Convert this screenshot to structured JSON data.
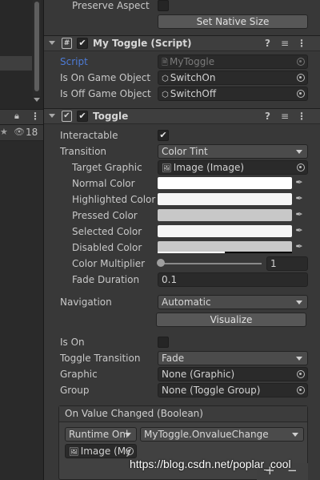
{
  "hierarchy": {
    "layer_count": "18",
    "lock_icon": "lock-icon",
    "menu_icon": "kebab-menu-icon",
    "star_icon": "star-icon",
    "eye_icon": "eye-slash-icon"
  },
  "top_partial": {
    "preserve_aspect_label": "Preserve Aspect",
    "preserve_aspect_checked": false,
    "set_native_size_label": "Set Native Size"
  },
  "my_toggle": {
    "title": "My Toggle (Script)",
    "enabled": true,
    "script_label": "Script",
    "script_value": "MyToggle",
    "is_on_label": "Is On Game Object",
    "is_on_value": "SwitchOn",
    "is_off_label": "Is Off Game Object",
    "is_off_value": "SwitchOff"
  },
  "toggle": {
    "title": "Toggle",
    "enabled": true,
    "interactable_label": "Interactable",
    "interactable_checked": true,
    "transition_label": "Transition",
    "transition_value": "Color Tint",
    "target_graphic_label": "Target Graphic",
    "target_graphic_value": "Image (Image)",
    "normal_color_label": "Normal Color",
    "normal_color": "#ffffff",
    "highlighted_color_label": "Highlighted Color",
    "highlighted_color": "#f5f5f5",
    "pressed_color_label": "Pressed Color",
    "pressed_color": "#c8c8c8",
    "selected_color_label": "Selected Color",
    "selected_color": "#f5f5f5",
    "disabled_color_label": "Disabled Color",
    "disabled_color": "#c8c8c8",
    "color_multiplier_label": "Color Multiplier",
    "color_multiplier_value": "1",
    "color_multiplier_fraction": 0.0,
    "fade_duration_label": "Fade Duration",
    "fade_duration_value": "0.1",
    "navigation_label": "Navigation",
    "navigation_value": "Automatic",
    "visualize_label": "Visualize",
    "is_on_label": "Is On",
    "is_on_checked": false,
    "toggle_transition_label": "Toggle Transition",
    "toggle_transition_value": "Fade",
    "graphic_label": "Graphic",
    "graphic_value": "None (Graphic)",
    "group_label": "Group",
    "group_value": "None (Toggle Group)"
  },
  "event": {
    "title": "On Value Changed (Boolean)",
    "runtime_value": "Runtime Onl",
    "function_value": "MyToggle.OnvalueChange",
    "object_value": "Image (My",
    "add_label": "+",
    "remove_label": "−"
  },
  "watermark": "https://blog.csdn.net/poplar_cool",
  "colors": {
    "accent_blue": "#4d7bd6",
    "panel": "#383838",
    "field": "#2a2a2a"
  }
}
